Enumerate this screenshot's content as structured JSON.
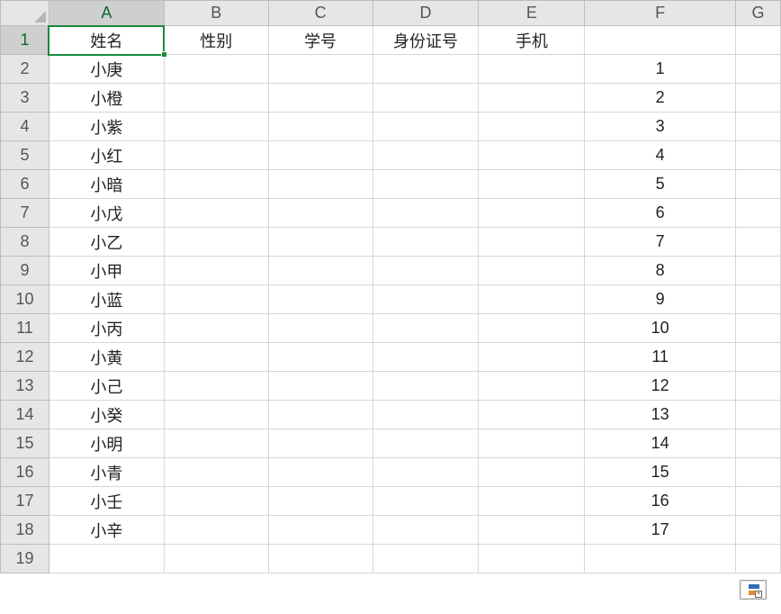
{
  "columns": [
    {
      "letter": "A",
      "cls": "col-A",
      "active": true
    },
    {
      "letter": "B",
      "cls": "col-B",
      "active": false
    },
    {
      "letter": "C",
      "cls": "col-C",
      "active": false
    },
    {
      "letter": "D",
      "cls": "col-D",
      "active": false
    },
    {
      "letter": "E",
      "cls": "col-E",
      "active": false
    },
    {
      "letter": "F",
      "cls": "col-F",
      "active": false
    },
    {
      "letter": "G",
      "cls": "col-G",
      "active": false
    }
  ],
  "row_count": 19,
  "active_row": 1,
  "active_col": "A",
  "rows": [
    {
      "num": 1,
      "A": "姓名",
      "B": "性别",
      "C": "学号",
      "D": "身份证号",
      "E": "手机",
      "F": ""
    },
    {
      "num": 2,
      "A": "小庚",
      "B": "",
      "C": "",
      "D": "",
      "E": "",
      "F": "1"
    },
    {
      "num": 3,
      "A": "小橙",
      "B": "",
      "C": "",
      "D": "",
      "E": "",
      "F": "2"
    },
    {
      "num": 4,
      "A": "小紫",
      "B": "",
      "C": "",
      "D": "",
      "E": "",
      "F": "3"
    },
    {
      "num": 5,
      "A": "小红",
      "B": "",
      "C": "",
      "D": "",
      "E": "",
      "F": "4"
    },
    {
      "num": 6,
      "A": "小暗",
      "B": "",
      "C": "",
      "D": "",
      "E": "",
      "F": "5"
    },
    {
      "num": 7,
      "A": "小戊",
      "B": "",
      "C": "",
      "D": "",
      "E": "",
      "F": "6"
    },
    {
      "num": 8,
      "A": "小乙",
      "B": "",
      "C": "",
      "D": "",
      "E": "",
      "F": "7"
    },
    {
      "num": 9,
      "A": "小甲",
      "B": "",
      "C": "",
      "D": "",
      "E": "",
      "F": "8"
    },
    {
      "num": 10,
      "A": "小蓝",
      "B": "",
      "C": "",
      "D": "",
      "E": "",
      "F": "9"
    },
    {
      "num": 11,
      "A": "小丙",
      "B": "",
      "C": "",
      "D": "",
      "E": "",
      "F": "10"
    },
    {
      "num": 12,
      "A": "小黄",
      "B": "",
      "C": "",
      "D": "",
      "E": "",
      "F": "11"
    },
    {
      "num": 13,
      "A": "小己",
      "B": "",
      "C": "",
      "D": "",
      "E": "",
      "F": "12"
    },
    {
      "num": 14,
      "A": "小癸",
      "B": "",
      "C": "",
      "D": "",
      "E": "",
      "F": "13"
    },
    {
      "num": 15,
      "A": "小明",
      "B": "",
      "C": "",
      "D": "",
      "E": "",
      "F": "14"
    },
    {
      "num": 16,
      "A": "小青",
      "B": "",
      "C": "",
      "D": "",
      "E": "",
      "F": "15"
    },
    {
      "num": 17,
      "A": "小壬",
      "B": "",
      "C": "",
      "D": "",
      "E": "",
      "F": "16"
    },
    {
      "num": 18,
      "A": "小辛",
      "B": "",
      "C": "",
      "D": "",
      "E": "",
      "F": "17"
    },
    {
      "num": 19,
      "A": "",
      "B": "",
      "C": "",
      "D": "",
      "E": "",
      "F": ""
    }
  ],
  "paste_options_label": "+"
}
